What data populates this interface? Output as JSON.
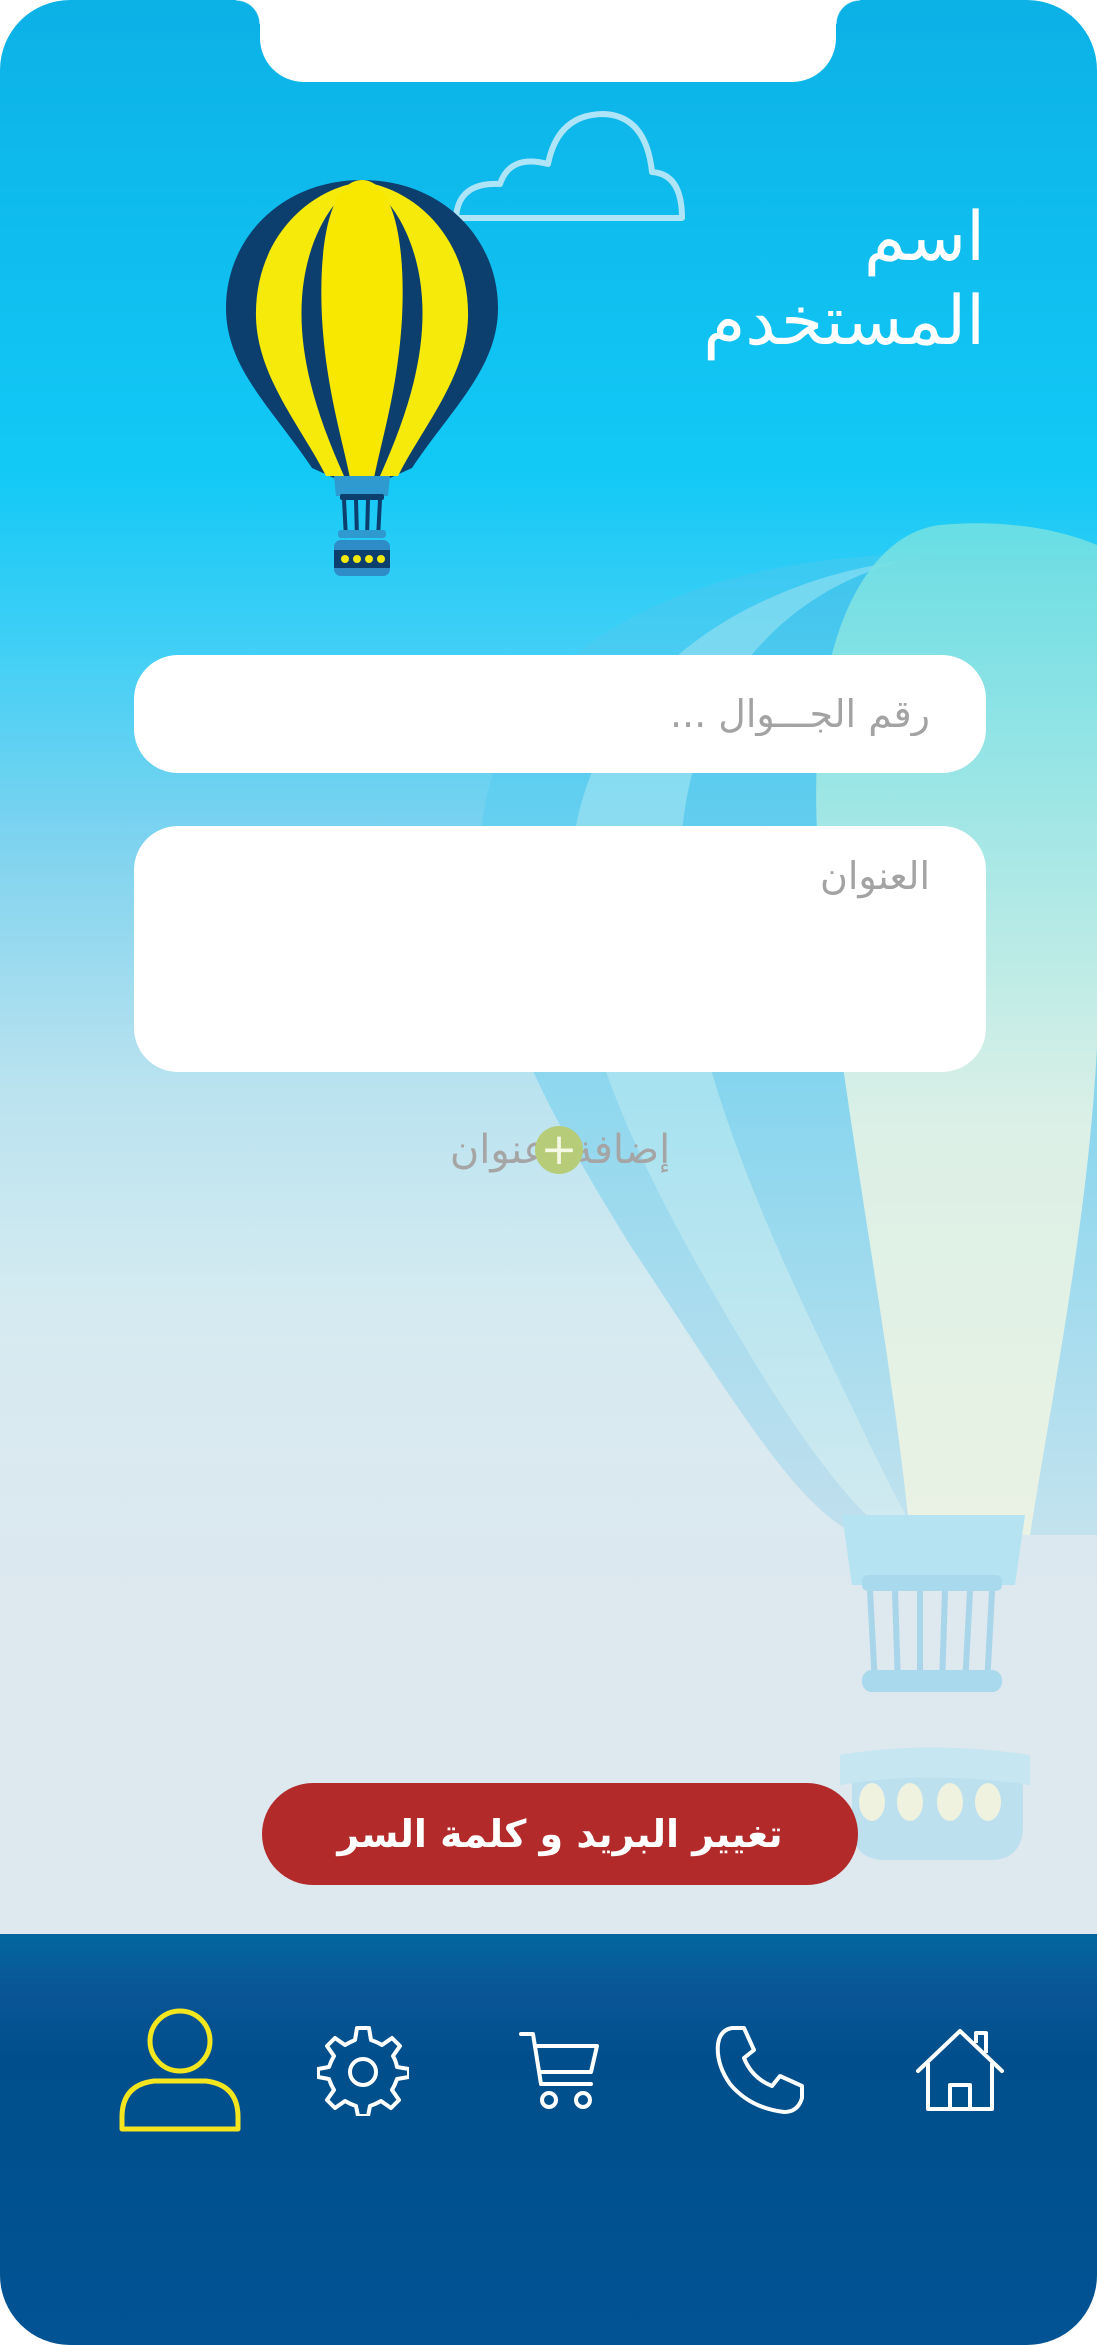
{
  "header": {
    "user_name": "اسم المستخدم"
  },
  "form": {
    "phone_placeholder": "رقم الجـــوال ...",
    "address_placeholder": "العنوان",
    "add_address_label": "إضافة  عنوان",
    "add_icon": "plus-circle-icon"
  },
  "actions": {
    "change_credentials_label": "تغيير البريد و كلمة السر"
  },
  "tabbar": {
    "items": [
      {
        "name": "profile",
        "icon": "user-icon",
        "active": true
      },
      {
        "name": "settings",
        "icon": "gear-icon",
        "active": false
      },
      {
        "name": "cart",
        "icon": "cart-icon",
        "active": false
      },
      {
        "name": "contact",
        "icon": "phone-icon",
        "active": false
      },
      {
        "name": "home",
        "icon": "home-icon",
        "active": false
      }
    ]
  },
  "colors": {
    "accent_red": "#b32a2a",
    "active_tab": "#f4e61e",
    "tab_icon": "#ffffff",
    "tabbar_bg": "#004f8c",
    "plus_green": "#b7cc78"
  }
}
